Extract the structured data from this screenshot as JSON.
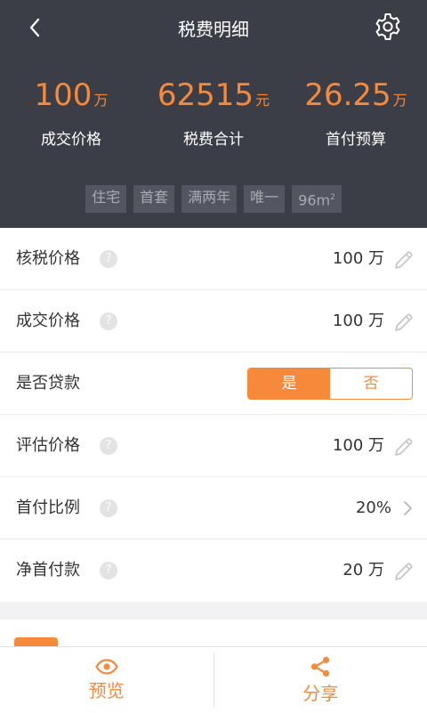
{
  "header": {
    "title": "税费明细",
    "stats": [
      {
        "number": "100",
        "unit": "万",
        "label": "成交价格"
      },
      {
        "number": "62515",
        "unit": "元",
        "label": "税费合计"
      },
      {
        "number": "26.25",
        "unit": "万",
        "label": "首付预算"
      }
    ],
    "tags": [
      "住宅",
      "首套",
      "满两年",
      "唯一",
      "96m"
    ],
    "area_superscript": "2"
  },
  "rows": {
    "tax_price": {
      "label": "核税价格",
      "value": "100 万"
    },
    "deal_price": {
      "label": "成交价格",
      "value": "100 万"
    },
    "loan": {
      "label": "是否贷款",
      "yes": "是",
      "no": "否",
      "selected": "是"
    },
    "appraisal_price": {
      "label": "评估价格",
      "value": "100 万"
    },
    "down_payment_ratio": {
      "label": "首付比例",
      "value": "20%"
    },
    "net_down_payment": {
      "label": "净首付款",
      "value": "20 万"
    }
  },
  "help_symbol": "?",
  "tabbar": {
    "preview": "预览",
    "share": "分享"
  },
  "colors": {
    "accent": "#f7893a",
    "header_bg": "#3b3e47",
    "tag_bg": "#535661"
  }
}
